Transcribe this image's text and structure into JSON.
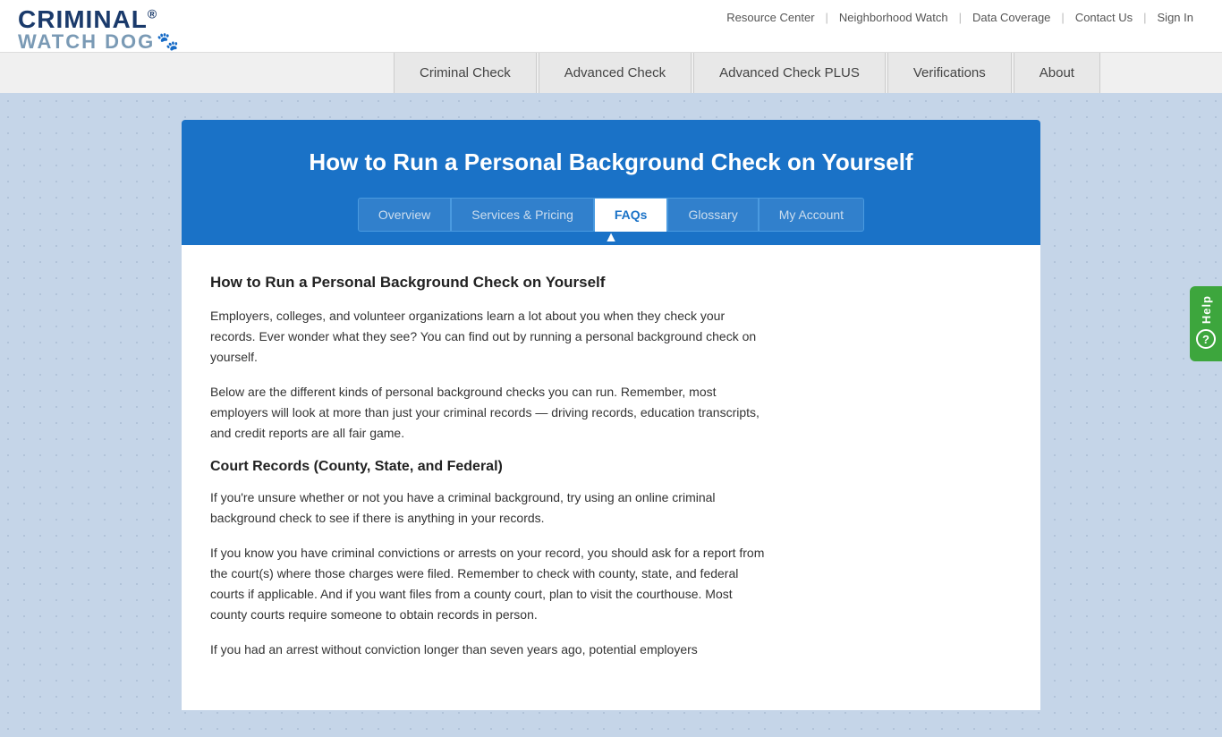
{
  "logo": {
    "criminal": "CRIMINAL",
    "reg": "®",
    "watchdog": "WATCH DOG"
  },
  "top_nav": {
    "items": [
      {
        "label": "Resource Center",
        "href": "#"
      },
      {
        "label": "Neighborhood Watch",
        "href": "#"
      },
      {
        "label": "Data Coverage",
        "href": "#"
      },
      {
        "label": "Contact Us",
        "href": "#"
      },
      {
        "label": "Sign In",
        "href": "#"
      }
    ]
  },
  "main_nav": {
    "items": [
      {
        "label": "Criminal Check",
        "href": "#",
        "active": false
      },
      {
        "label": "Advanced Check",
        "href": "#",
        "active": false
      },
      {
        "label": "Advanced Check PLUS",
        "href": "#",
        "active": false
      },
      {
        "label": "Verifications",
        "href": "#",
        "active": false
      },
      {
        "label": "About",
        "href": "#",
        "active": false
      }
    ]
  },
  "banner": {
    "title": "How to Run a Personal Background Check on Yourself"
  },
  "sub_tabs": {
    "items": [
      {
        "label": "Overview",
        "active": false
      },
      {
        "label": "Services & Pricing",
        "active": false
      },
      {
        "label": "FAQs",
        "active": true
      },
      {
        "label": "Glossary",
        "active": false
      },
      {
        "label": "My Account",
        "active": false
      }
    ]
  },
  "content": {
    "heading": "How to Run a Personal Background Check on Yourself",
    "paragraph1": "Employers, colleges, and volunteer organizations learn a lot about you when they check your records. Ever wonder what they see? You can find out by running a personal background check on yourself.",
    "paragraph2": "Below are the different kinds of personal background checks you can run. Remember, most employers will look at more than just your criminal records — driving records, education transcripts, and credit reports are all fair game.",
    "section1_title": "Court Records (County, State, and Federal)",
    "paragraph3": "If you're unsure whether or not you have a criminal background, try using an online criminal background check to see if there is anything in your records.",
    "paragraph4": "If you know you have criminal convictions or arrests on your record, you should ask for a report from the court(s) where those charges were filed. Remember to check with county, state, and federal courts if applicable. And if you want files from a county court, plan to visit the courthouse. Most county courts require someone to obtain records in person.",
    "paragraph5": "If you had an arrest without conviction longer than seven years ago, potential employers"
  },
  "help": {
    "label": "Help",
    "icon": "?"
  }
}
